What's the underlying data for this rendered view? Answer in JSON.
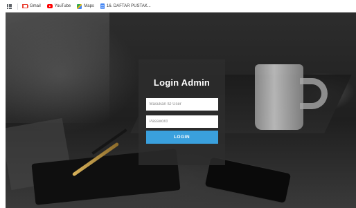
{
  "bookmarks": {
    "items": [
      {
        "label": "Gmail",
        "icon": "gmail-icon"
      },
      {
        "label": "YouTube",
        "icon": "youtube-icon"
      },
      {
        "label": "Maps",
        "icon": "maps-icon"
      },
      {
        "label": "16. DAFTAR PUSTAK...",
        "icon": "document-icon"
      }
    ]
  },
  "login": {
    "title": "Login Admin",
    "user_placeholder": "Masukan ID User",
    "password_placeholder": "Password",
    "button_label": "LOGIN"
  },
  "colors": {
    "button": "#3aa0dd",
    "card": "#2d2d2d"
  }
}
